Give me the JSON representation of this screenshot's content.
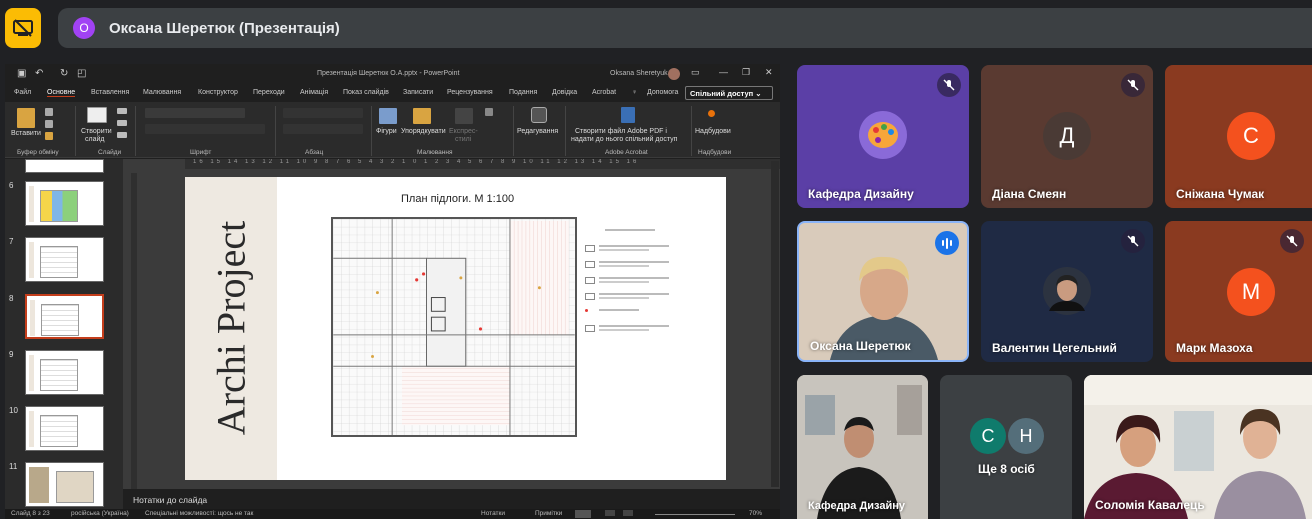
{
  "meet": {
    "presenter_initial": "О",
    "presenter_label": "Оксана Шеретюк (Презентація)",
    "colors": {
      "present_button": "#fbbc04",
      "speaking": "#1a73e8",
      "background": "#202124"
    }
  },
  "powerpoint": {
    "window_title": "Презентація Шеретюк О.А.pptx  -  PowerPoint",
    "user": "Oksana Sheretyuk",
    "menu": [
      "Файл",
      "Основне",
      "Вставлення",
      "Малювання",
      "Конструктор",
      "Переходи",
      "Анімація",
      "Показ слайдів",
      "Записати",
      "Рецензування",
      "Подання",
      "Довідка",
      "Acrobat"
    ],
    "search_label": "Допомога",
    "share_label": "Спільний доступ",
    "ribbon": {
      "paste": "Вставити",
      "new_slide_1": "Створити",
      "new_slide_2": "слайд",
      "shapes": "Фігури",
      "arrange": "Упорядкувати",
      "quick_styles_1": "Експрес-",
      "quick_styles_2": "стилі",
      "editing": "Редагування",
      "acrobat_1": "Створити файл Adobe PDF і",
      "acrobat_2": "надати до нього спільний доступ",
      "addins": "Надбудови",
      "groups": [
        "Буфер обміну",
        "Слайди",
        "Шрифт",
        "Абзац",
        "Малювання",
        "Adobe Acrobat",
        "Надбудови"
      ]
    },
    "thumbnails": [
      "6",
      "7",
      "8",
      "9",
      "10",
      "11"
    ],
    "ruler_marks": "16 15 14 13 12 11 10 9 8 7 6 5 4 3 2 1 0 1 2 3 4 5 6 7 8 9 10 11 12 13 14 15 16",
    "slide": {
      "vertical_title": "Archi Project",
      "plan_title": "План підлоги. М 1:100"
    },
    "notes_label": "Нотатки до слайда",
    "status": {
      "slide_counter": "Слайд 8 з 23",
      "language": "російська (Україна)",
      "accessibility": "Спеціальні можливості: щось не так",
      "notes": "Нотатки",
      "comments": "Примітки",
      "zoom": "70%"
    }
  },
  "participants": [
    {
      "name": "Кафедра Дизайну",
      "muted": true
    },
    {
      "name": "Діана Смеян",
      "initial": "Д",
      "muted": true
    },
    {
      "name": "Сніжана Чумак",
      "initial": "С",
      "muted": false
    },
    {
      "name": "Оксана Шеретюк",
      "speaking": true
    },
    {
      "name": "Валентин Цегельний",
      "muted": true
    },
    {
      "name": "Марк Мазоха",
      "initial": "М",
      "muted": true
    },
    {
      "name": "Кафедра Дизайну",
      "muted": false
    },
    {
      "name": "Ще 8 осіб",
      "initials": [
        "С",
        "Н"
      ]
    },
    {
      "name": "Соломія Кавалець",
      "muted": false
    }
  ]
}
